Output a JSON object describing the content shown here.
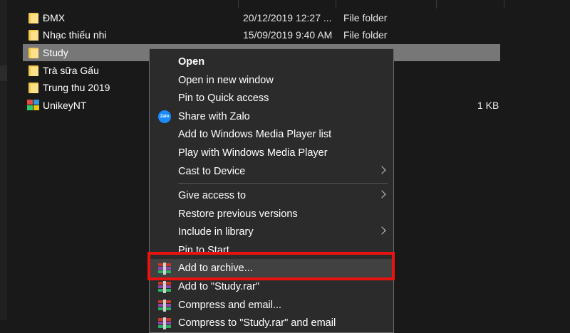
{
  "files": [
    {
      "name": "ĐMX",
      "date": "20/12/2019 12:27 ...",
      "type": "File folder",
      "size": "",
      "icon": "folder-icon",
      "selected": false
    },
    {
      "name": "Nhạc thiếu nhi",
      "date": "15/09/2019 9:40 AM",
      "type": "File folder",
      "size": "",
      "icon": "folder-icon",
      "selected": false
    },
    {
      "name": "Study",
      "date": "",
      "type": "",
      "size": "",
      "icon": "folder-icon",
      "selected": true
    },
    {
      "name": "Trà sữa Gấu",
      "date": "",
      "type": "",
      "size": "",
      "icon": "folder-icon",
      "selected": false
    },
    {
      "name": "Trung thu 2019",
      "date": "",
      "type": "",
      "size": "",
      "icon": "folder-icon",
      "selected": false
    },
    {
      "name": "UnikeyNT",
      "date": "",
      "type": "",
      "size": "1 KB",
      "icon": "unikey-icon",
      "selected": false
    }
  ],
  "context_menu": {
    "groups": [
      [
        {
          "label": "Open",
          "bold": true
        },
        {
          "label": "Open in new window"
        },
        {
          "label": "Pin to Quick access"
        },
        {
          "label": "Share with Zalo",
          "icon": "zalo-icon"
        },
        {
          "label": "Add to Windows Media Player list"
        },
        {
          "label": "Play with Windows Media Player"
        },
        {
          "label": "Cast to Device",
          "submenu": true
        }
      ],
      [
        {
          "label": "Give access to",
          "submenu": true
        },
        {
          "label": "Restore previous versions"
        },
        {
          "label": "Include in library",
          "submenu": true
        },
        {
          "label": "Pin to Start"
        },
        {
          "label": "Add to archive...",
          "icon": "winrar-icon",
          "highlighted": true
        },
        {
          "label": "Add to \"Study.rar\"",
          "icon": "winrar-icon"
        },
        {
          "label": "Compress and email...",
          "icon": "winrar-icon"
        },
        {
          "label": "Compress to \"Study.rar\" and email",
          "icon": "winrar-icon"
        }
      ]
    ],
    "zalo_icon_text": "Zalo"
  },
  "colors": {
    "background": "#191919",
    "menu_background": "#2b2b2b",
    "selected_row": "#777777",
    "highlight_box": "#e8130f",
    "folder": "#f2c94c"
  }
}
